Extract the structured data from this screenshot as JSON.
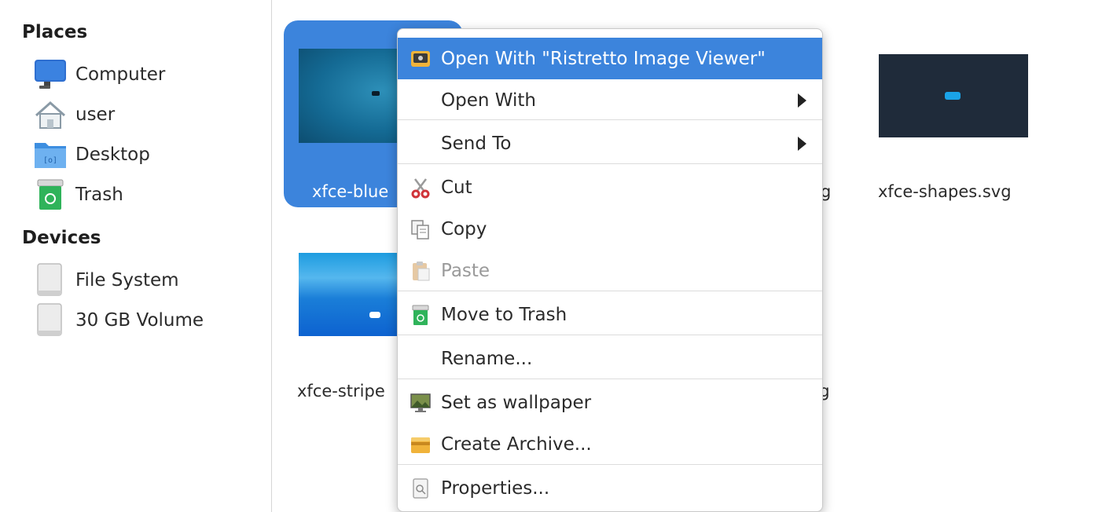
{
  "sidebar": {
    "places_title": "Places",
    "places": [
      {
        "label": "Computer",
        "icon": "computer-icon"
      },
      {
        "label": "user",
        "icon": "home-icon"
      },
      {
        "label": "Desktop",
        "icon": "desktop-folder-icon"
      },
      {
        "label": "Trash",
        "icon": "trash-icon"
      }
    ],
    "devices_title": "Devices",
    "devices": [
      {
        "label": "File System",
        "icon": "drive-icon"
      },
      {
        "label": "30 GB Volume",
        "icon": "drive-icon"
      }
    ]
  },
  "files": [
    {
      "name": "xfce-blue",
      "selected": true
    },
    {
      "name": "g"
    },
    {
      "name": "xfce-shapes.svg"
    },
    {
      "name": "xfce-stripe"
    },
    {
      "name": "ng"
    }
  ],
  "context_menu": {
    "items": [
      {
        "label": "Open With \"Ristretto Image Viewer\"",
        "icon": "image-viewer-icon"
      },
      {
        "label": "Open With",
        "submenu": true
      },
      {
        "label": "Send To",
        "submenu": true
      },
      {
        "label": "Cut",
        "icon": "scissors-icon"
      },
      {
        "label": "Copy",
        "icon": "copy-icon"
      },
      {
        "label": "Paste",
        "icon": "paste-icon",
        "disabled": true
      },
      {
        "label": "Move to Trash",
        "icon": "trash-icon"
      },
      {
        "label": "Rename..."
      },
      {
        "label": "Set as wallpaper",
        "icon": "wallpaper-icon"
      },
      {
        "label": "Create Archive...",
        "icon": "archive-icon"
      },
      {
        "label": "Properties...",
        "icon": "properties-icon"
      }
    ]
  },
  "colors": {
    "accent": "#3c84dc",
    "arrow": "#1aa3e8"
  }
}
